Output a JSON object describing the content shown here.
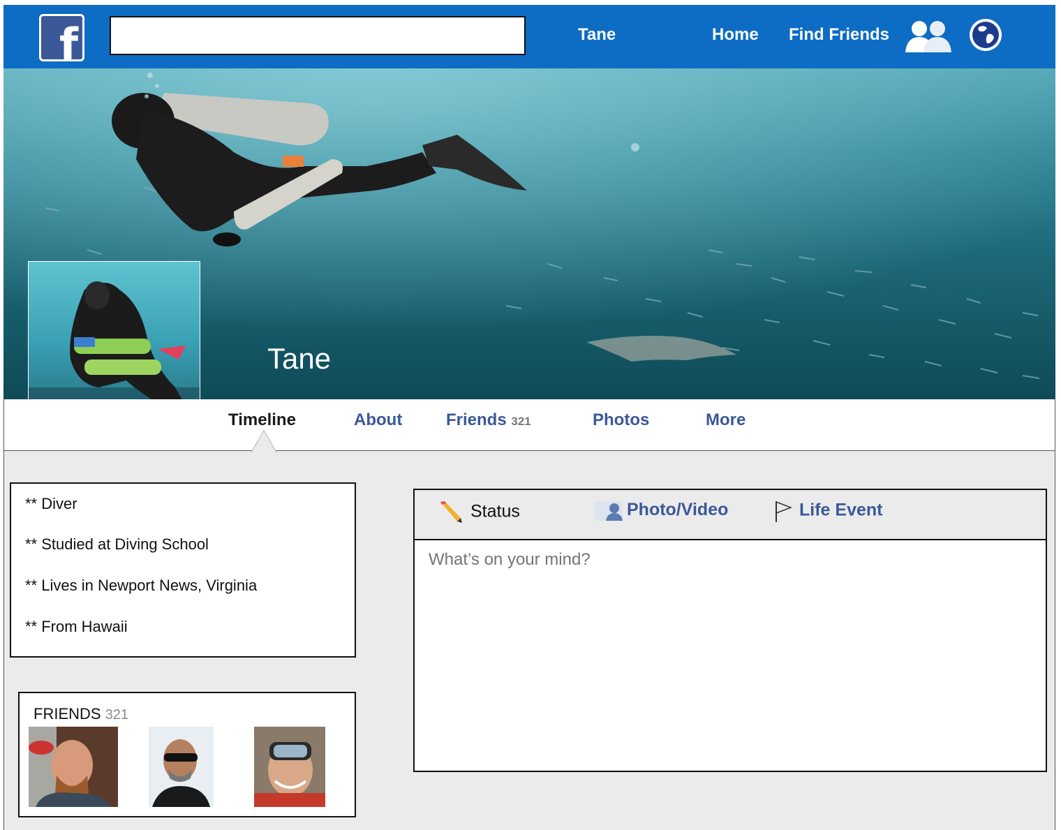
{
  "header": {
    "nav": {
      "profile_label": "Tane",
      "home_label": "Home",
      "find_friends_label": "Find Friends"
    },
    "search": {
      "value": ""
    }
  },
  "cover": {
    "name": "Tane"
  },
  "tabs": [
    {
      "label": "Timeline",
      "active": true
    },
    {
      "label": "About"
    },
    {
      "label": "Friends",
      "count": "321"
    },
    {
      "label": "Photos"
    },
    {
      "label": "More"
    }
  ],
  "about": {
    "items": [
      "** Diver",
      "** Studied at Diving School",
      "** Lives in Newport News, Virginia",
      "** From Hawaii"
    ]
  },
  "friends": {
    "title": "FRIENDS",
    "count": "321"
  },
  "composer": {
    "status_label": "Status",
    "photo_label": "Photo/Video",
    "life_event_label": "Life Event",
    "placeholder": "What’s on your mind?"
  },
  "colors": {
    "top_bar": "#0d6cc4",
    "link": "#3b5998",
    "background": "#ebebeb"
  },
  "icons": [
    "facebook-logo-icon",
    "friend-requests-icon",
    "globe-icon",
    "pencil-icon",
    "photo-icon",
    "flag-icon"
  ]
}
